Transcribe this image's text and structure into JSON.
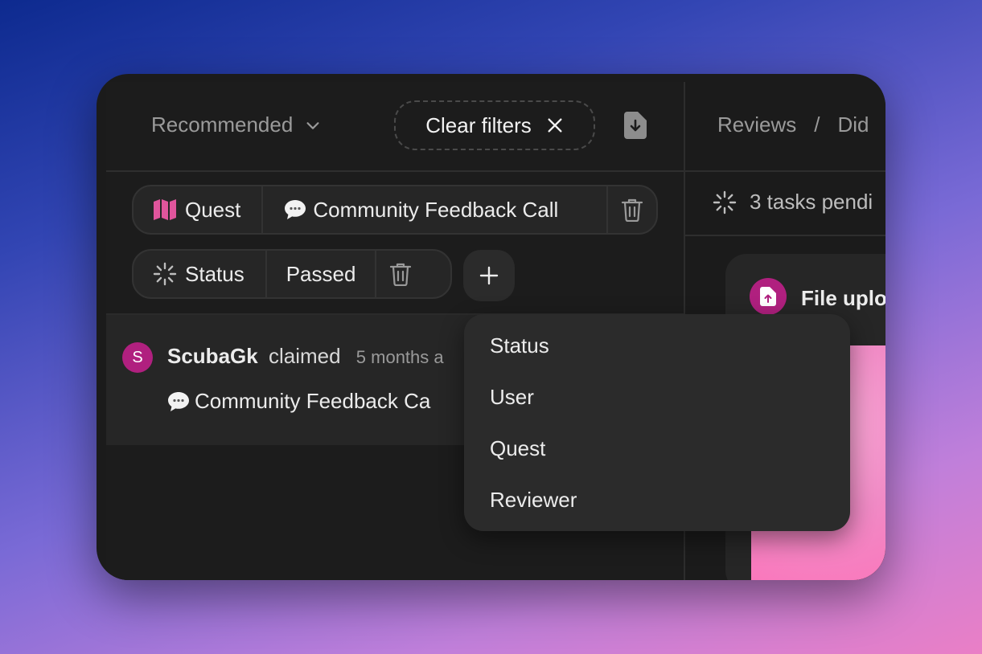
{
  "toolbar": {
    "sort_label": "Recommended",
    "clear_filters_label": "Clear filters"
  },
  "filters": [
    {
      "field": "Quest",
      "value": "Community Feedback Call"
    },
    {
      "field": "Status",
      "value": "Passed"
    }
  ],
  "activity": {
    "avatar_initial": "S",
    "user": "ScubaGk",
    "verb": "claimed",
    "time": "5 months a",
    "quest": "Community Feedback Ca"
  },
  "add_filter_menu": {
    "items": [
      "Status",
      "User",
      "Quest",
      "Reviewer"
    ]
  },
  "right_panel": {
    "breadcrumb": [
      "Reviews",
      "Did"
    ],
    "breadcrumb_separator": "/",
    "pending_text": "3 tasks pendi",
    "card_title": "File uplo"
  },
  "colors": {
    "accent_magenta": "#b0207f",
    "quest_icon": "#e0559c",
    "image_pink": "#f08ac5"
  },
  "icons": {
    "sort": "chevron-down-icon",
    "clear": "close-icon",
    "export": "file-download-icon",
    "quest": "map-icon",
    "speech": "speech-bubble-icon",
    "status": "loader-icon",
    "delete": "trash-icon",
    "add": "plus-icon",
    "file_upload": "file-upload-icon"
  }
}
